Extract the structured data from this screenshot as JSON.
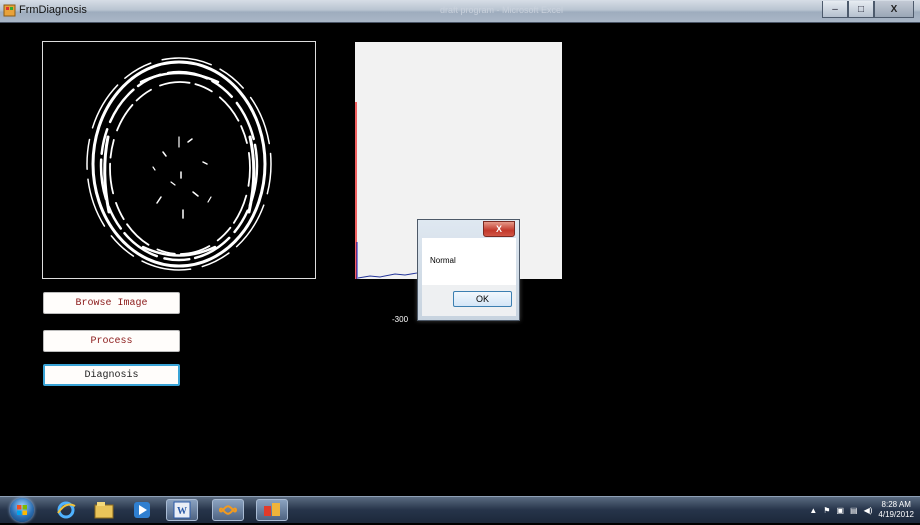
{
  "window": {
    "title": "FrmDiagnosis",
    "background_title": "draft program - Microsoft Excel",
    "minimize_label": "–",
    "maximize_label": "□",
    "close_label": "X"
  },
  "buttons": {
    "browse_label": "Browse Image",
    "process_label": "Process",
    "diagnosis_label": "Diagnosis"
  },
  "chart": {
    "axis_tick_label": "-300"
  },
  "message_box": {
    "message": "Normal",
    "ok_label": "OK",
    "close_label": "X"
  },
  "taskbar": {
    "items": [
      "start-orb",
      "ie-icon",
      "explorer-icon",
      "media-player-icon",
      "word-icon",
      "infinity-app-icon",
      "form-app-icon"
    ],
    "clock_time": "8:28 AM",
    "clock_date": "4/19/2012"
  },
  "colors": {
    "background": "#000000",
    "button_text": "#8b1a1a",
    "focus_border": "#39a3d6",
    "chart_background": "#f2f2f2"
  }
}
